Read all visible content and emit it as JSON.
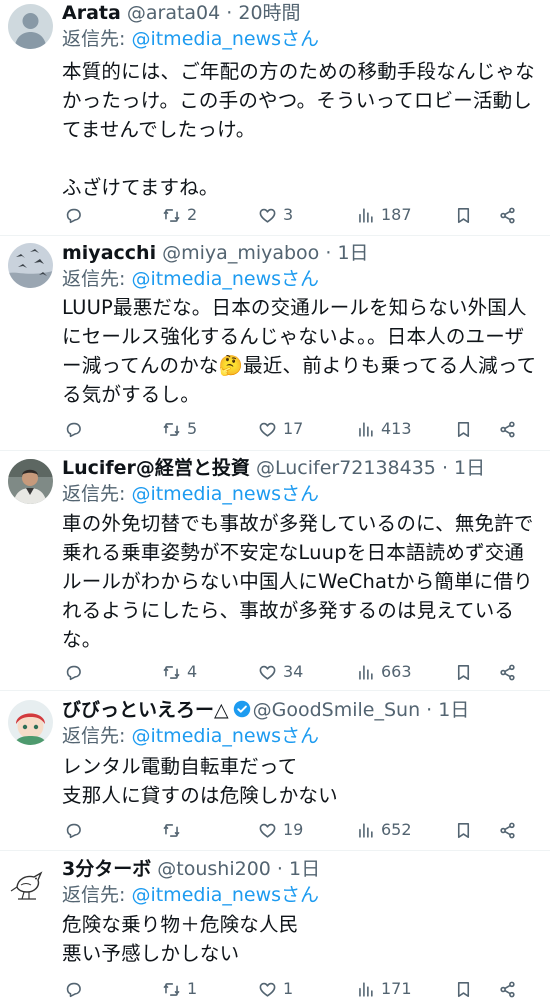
{
  "tweets": [
    {
      "name": "Arata",
      "handle": "@arata04",
      "time": "20時間",
      "reply_prefix": "返信先: ",
      "reply_to": "@itmedia_newsさん",
      "text": "本質的には、ご年配の方のための移動手段なんじゃなかったっけ。この手のやつ。そういってロビー活動してませんでしたっけ。\n\nふざけてますね。",
      "replies": "",
      "retweets": "2",
      "likes": "3",
      "views": "187",
      "avatar": "default-person-icon"
    },
    {
      "name": "miyacchi",
      "handle": "@miya_miyaboo",
      "time": "1日",
      "reply_prefix": "返信先: ",
      "reply_to": "@itmedia_newsさん",
      "text": "LUUP最悪だな。日本の交通ルールを知らない外国人にセールス強化するんじゃないよ。。日本人のユーザー減ってんのかな🤔最近、前よりも乗ってる人減ってる気がするし。",
      "replies": "",
      "retweets": "5",
      "likes": "17",
      "views": "413",
      "avatar": "flying-birds-photo"
    },
    {
      "name": "Lucifer@経営と投資",
      "handle": "@Lucifer72138435",
      "time": "1日",
      "reply_prefix": "返信先: ",
      "reply_to": "@itmedia_newsさん",
      "text": "車の外免切替でも事故が多発しているのに、無免許で乗れる乗車姿勢が不安定なLuupを日本語読めず交通ルールがわからない中国人にWeChatから簡単に借りれるようにしたら、事故が多発するのは見えているな。",
      "replies": "",
      "retweets": "4",
      "likes": "34",
      "views": "663",
      "avatar": "person-photo"
    },
    {
      "name": "びびっといえろー△",
      "handle": "@GoodSmile_Sun",
      "time": "1日",
      "reply_prefix": "返信先: ",
      "reply_to": "@itmedia_newsさん",
      "text": "レンタル電動自転車だって\n支那人に貸すのは危険しかない",
      "replies": "",
      "retweets": "",
      "likes": "19",
      "views": "652",
      "avatar": "anime-character-icon",
      "verified": true
    },
    {
      "name": "3分ターボ",
      "handle": "@toushi200",
      "time": "1日",
      "reply_prefix": "返信先: ",
      "reply_to": "@itmedia_newsさん",
      "text": "危険な乗り物＋危険な人民\n悪い予感しかしない",
      "replies": "",
      "retweets": "1",
      "likes": "1",
      "views": "171",
      "avatar": "bird-sketch-icon"
    }
  ],
  "colors": {
    "text": "#0f1419",
    "secondary": "#536471",
    "link": "#1d9bf0",
    "divider": "#eff3f4"
  }
}
